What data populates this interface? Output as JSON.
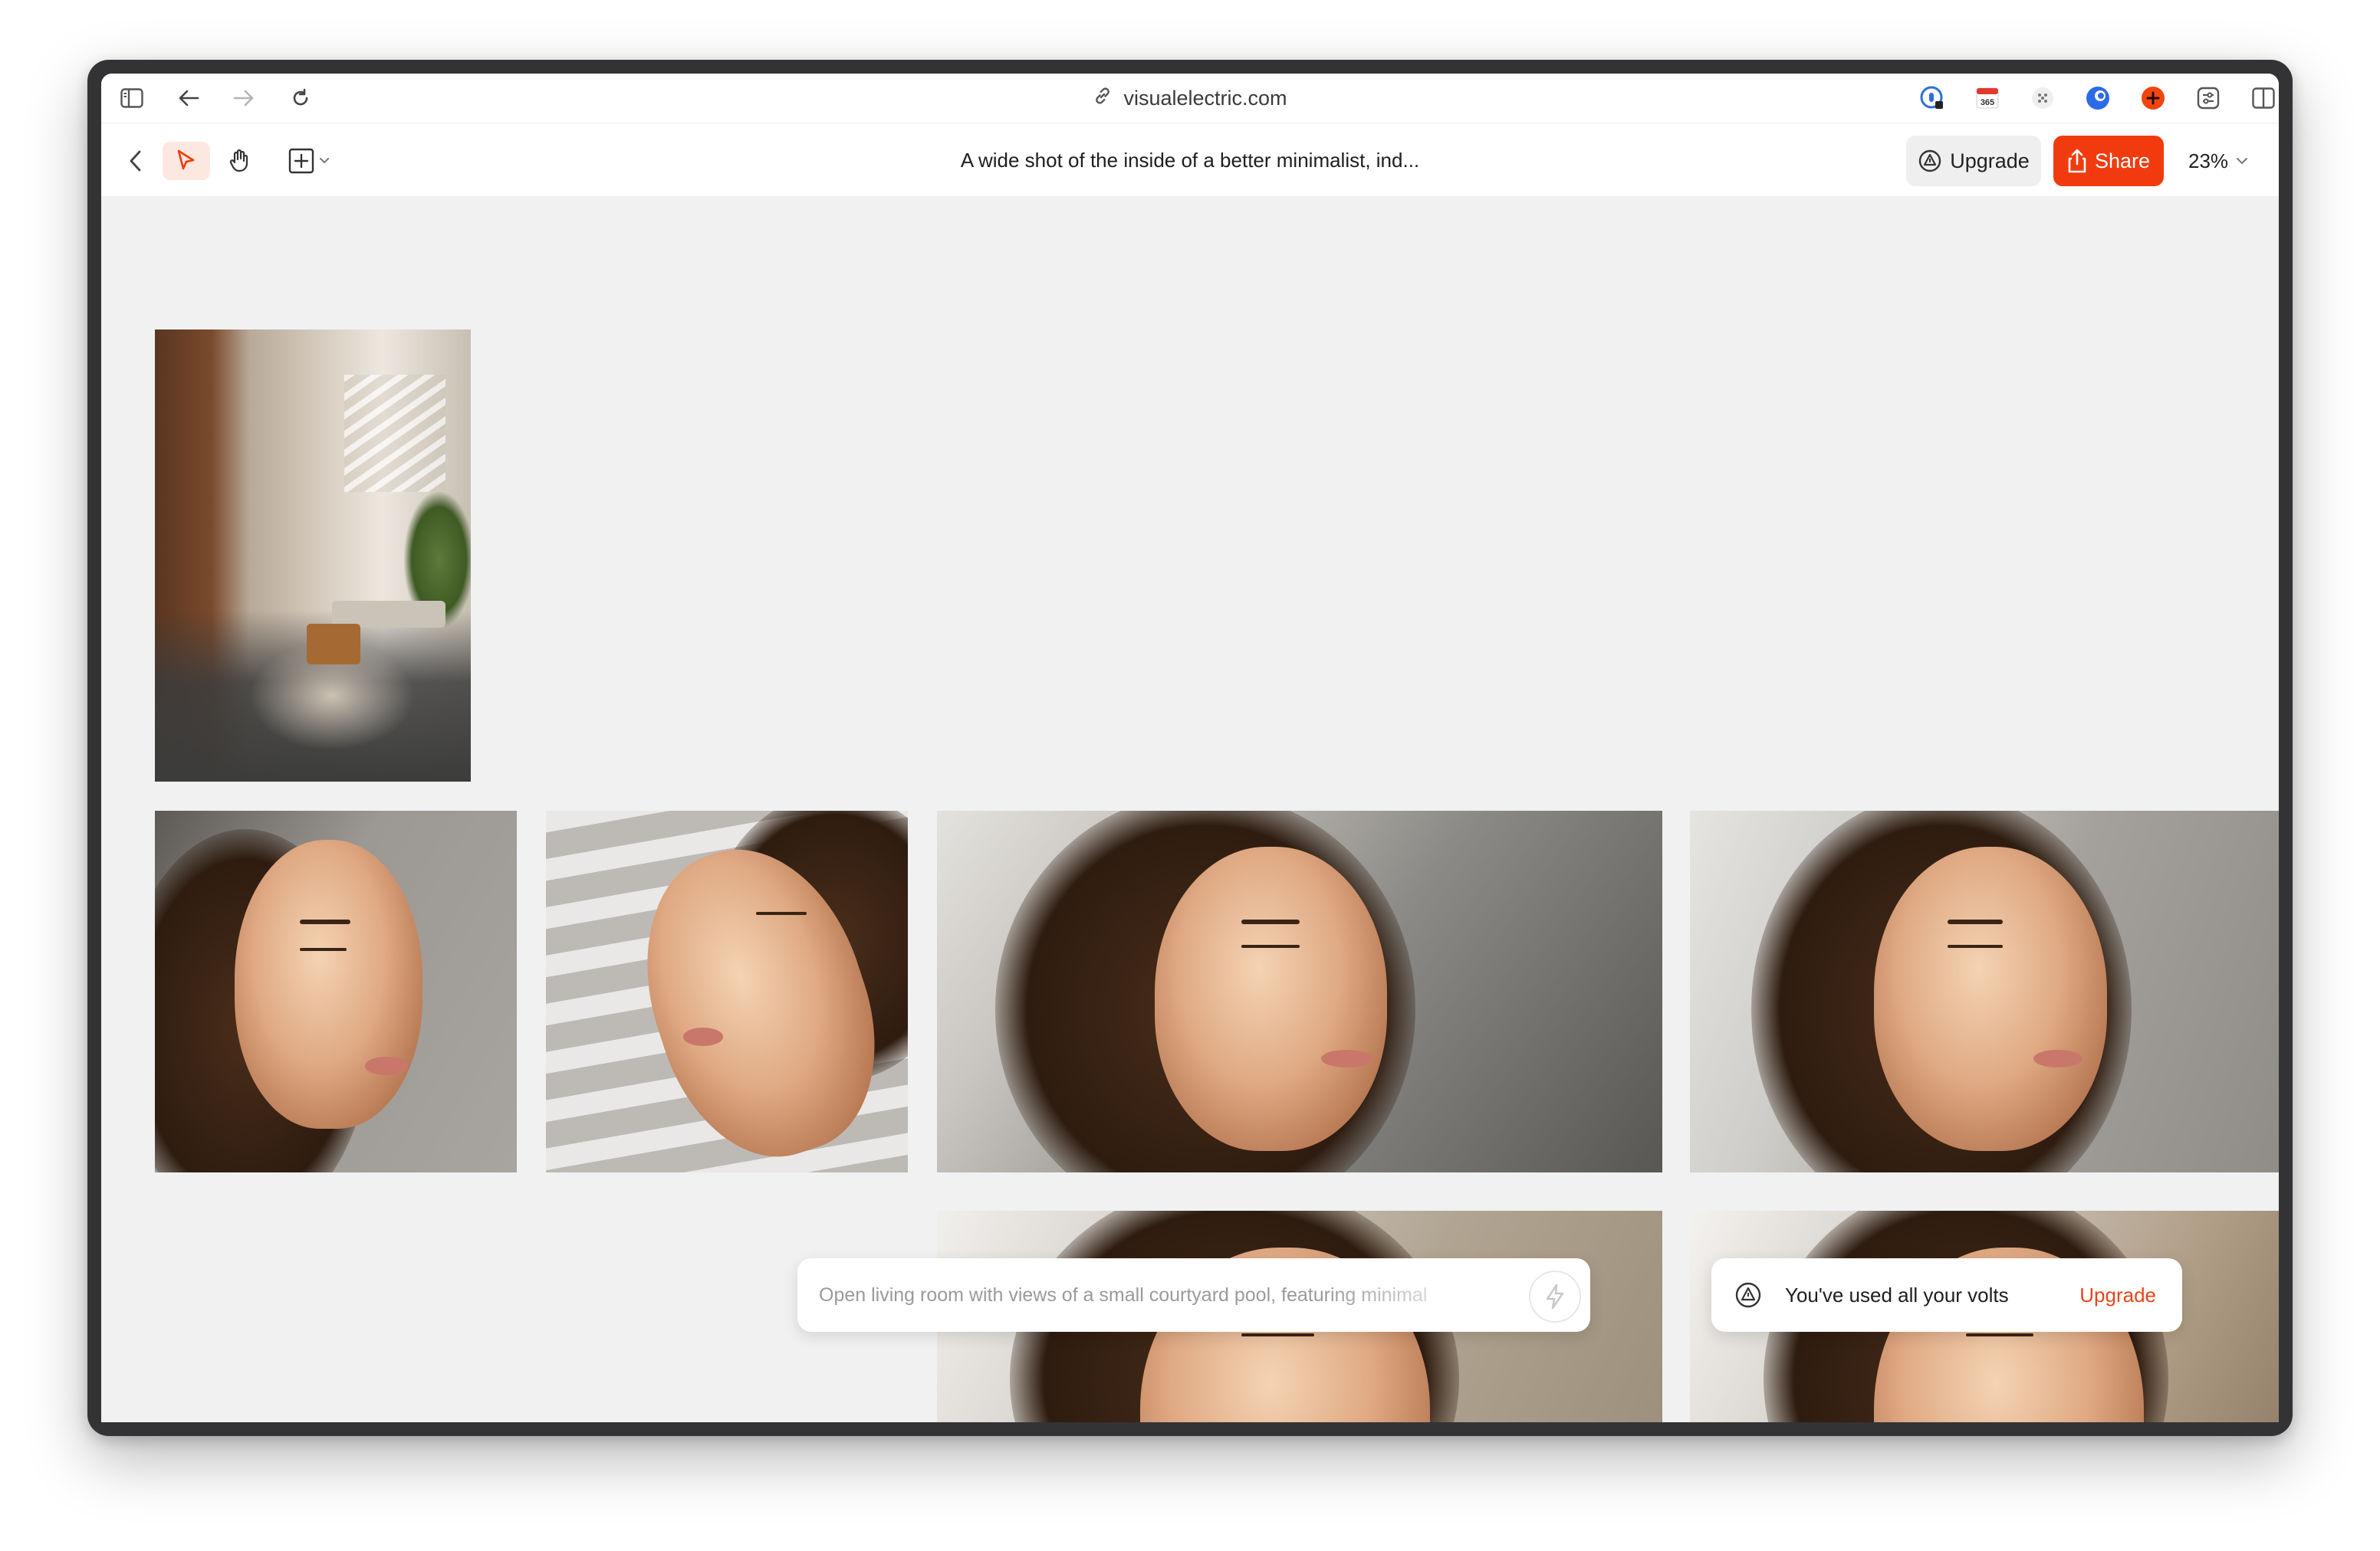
{
  "browser": {
    "url": "visualelectric.com",
    "extensions": [
      {
        "name": "password-icon",
        "color": "#2f6fda"
      },
      {
        "name": "calendar-365-icon",
        "label": "365",
        "color": "#e03a2f"
      },
      {
        "name": "dots-icon",
        "color": "#8a8a8a"
      },
      {
        "name": "blue-ball-icon",
        "color": "#2e6be6"
      },
      {
        "name": "red-plus-icon",
        "color": "#f1460f"
      },
      {
        "name": "sliders-icon",
        "color": "#555555"
      }
    ]
  },
  "toolbar": {
    "title": "A wide shot of the inside of a better minimalist, ind...",
    "upgrade_label": "Upgrade",
    "share_label": "Share",
    "zoom": "23%",
    "accent": "#f13b0e"
  },
  "canvas": {
    "images": [
      {
        "name": "interior-image",
        "subject": "room"
      },
      {
        "name": "portrait-image-1",
        "subject": "portrait"
      },
      {
        "name": "portrait-image-2",
        "subject": "portrait"
      },
      {
        "name": "portrait-image-3",
        "subject": "portrait"
      },
      {
        "name": "portrait-image-4",
        "subject": "portrait"
      },
      {
        "name": "portrait-image-5",
        "subject": "portrait"
      },
      {
        "name": "portrait-image-6",
        "subject": "portrait"
      }
    ]
  },
  "prompt": {
    "placeholder": "Open living room with views of a small courtyard pool, featuring minimal"
  },
  "volts": {
    "message": "You've used all your volts",
    "link": "Upgrade"
  }
}
